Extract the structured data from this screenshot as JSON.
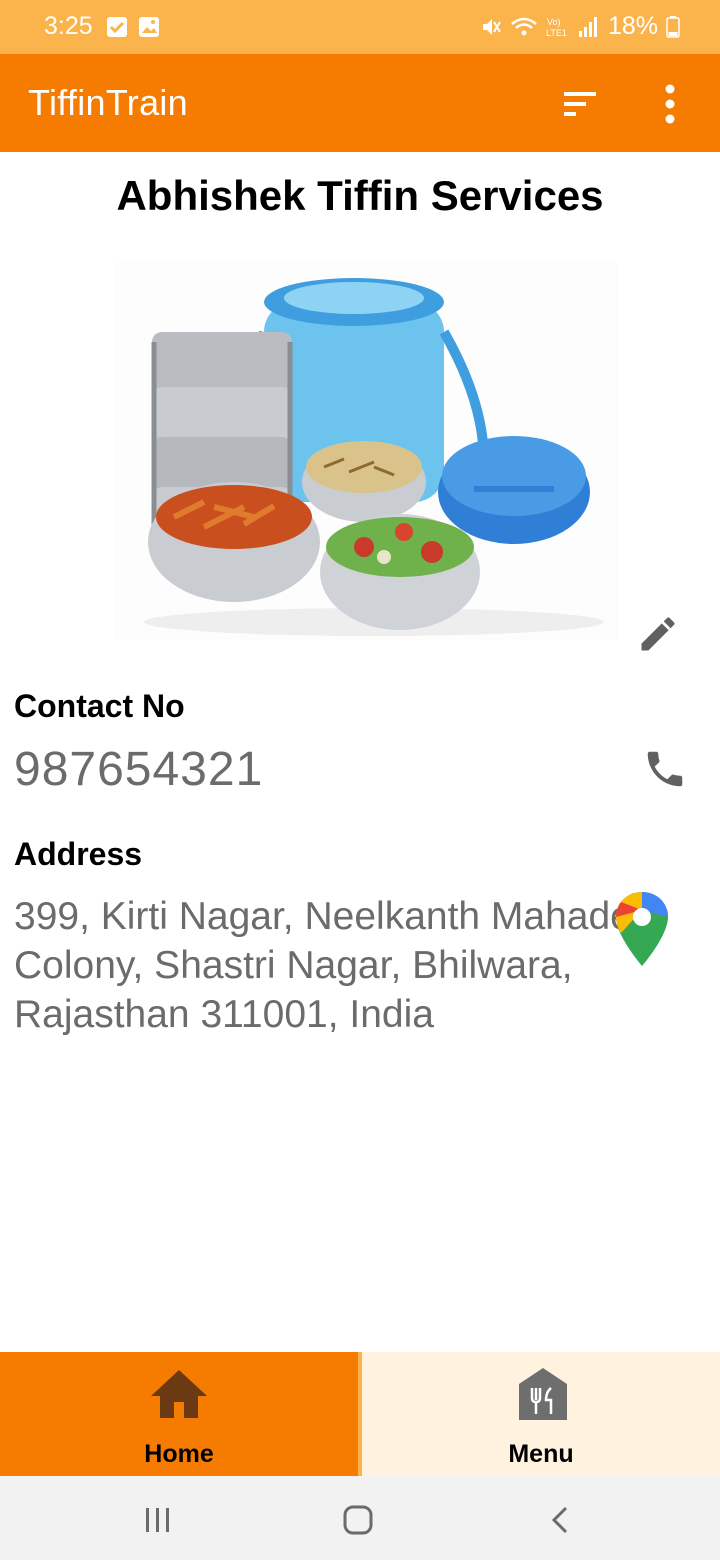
{
  "status_bar": {
    "time": "3:25",
    "battery": "18%",
    "left_icons": [
      "checkbox-notification-icon",
      "gallery-notification-icon"
    ],
    "right_icons": [
      "mute-vibrate-icon",
      "wifi-icon",
      "volte-lte-icon",
      "signal-icon",
      "battery-icon"
    ]
  },
  "app_bar": {
    "title": "TiffinTrain",
    "actions": [
      "sort-icon",
      "more-vert-icon"
    ]
  },
  "content": {
    "shop_name": "Abhishek Tiffin Services",
    "contact_label": "Contact No",
    "contact_value": "987654321",
    "address_label": "Address",
    "address_value": "399, Kirti Nagar, Neelkanth Mahadev Colony, Shastri Nagar, Bhilwara, Rajasthan 311001, India"
  },
  "bottom_nav": {
    "items": [
      {
        "label": "Home",
        "icon": "home-icon",
        "selected": true
      },
      {
        "label": "Menu",
        "icon": "restaurant-menu-icon",
        "selected": false
      }
    ]
  },
  "colors": {
    "status_bar": "#fbb34c",
    "app_bar": "#f57c00",
    "nav_selected": "#f57c00",
    "nav_unselected": "#fff2df",
    "secondary_text": "#6b6b6b",
    "icon_gray": "#616161"
  }
}
